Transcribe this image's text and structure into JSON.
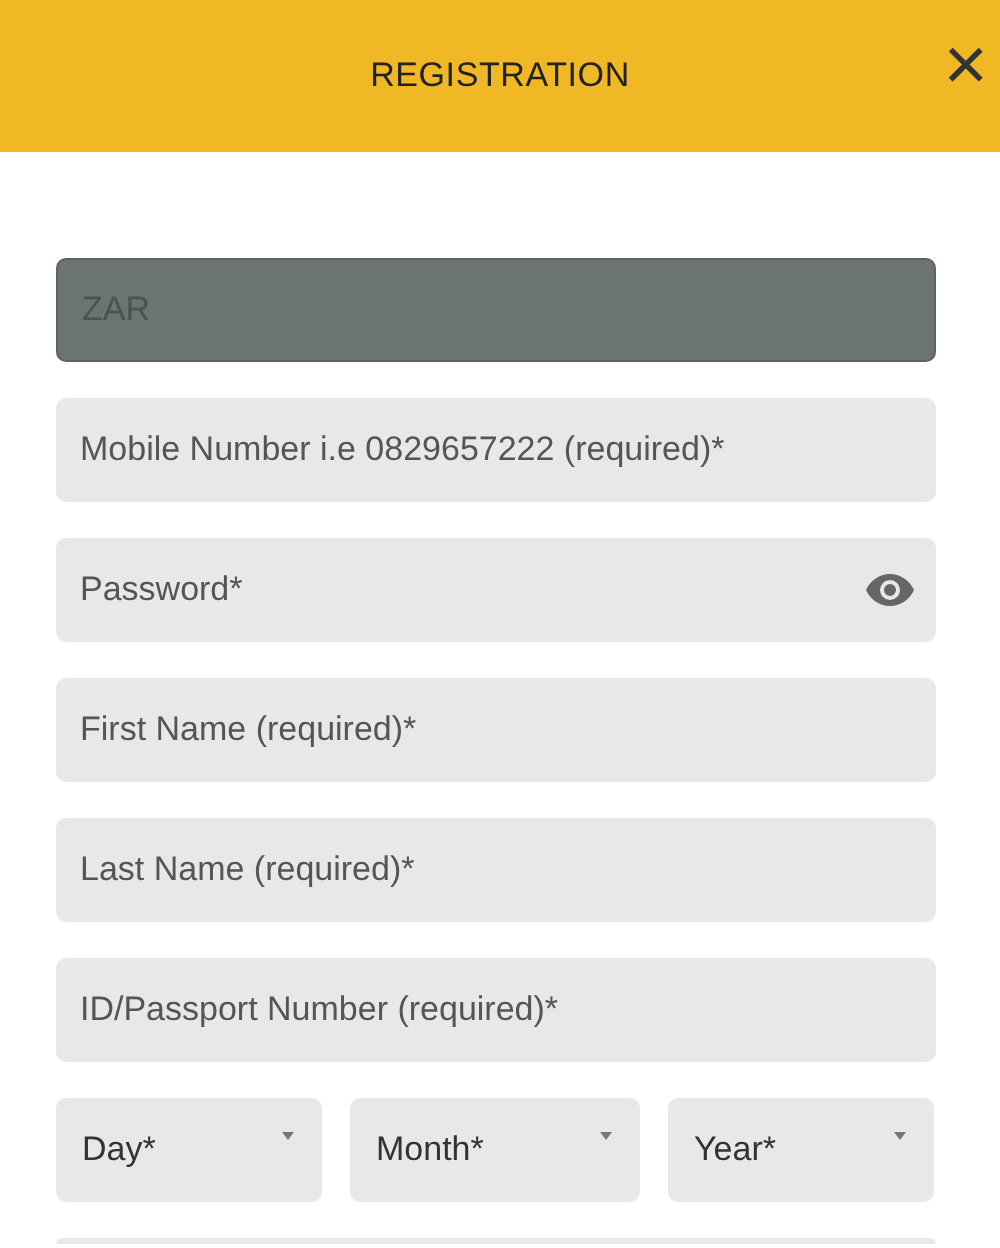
{
  "header": {
    "title": "REGISTRATION",
    "close": "×"
  },
  "fields": [
    {
      "kind": "text",
      "value": "ZAR",
      "disabled": true
    },
    {
      "kind": "text",
      "placeholder": "Mobile Number i.e 0829657222 (required)*",
      "disabled": false
    },
    {
      "kind": "password",
      "placeholder": "Password*",
      "disabled": false
    },
    {
      "kind": "text",
      "placeholder": "First Name (required)*",
      "disabled": false
    },
    {
      "kind": "text",
      "placeholder": "Last Name (required)*",
      "disabled": false
    },
    {
      "kind": "text",
      "placeholder": "ID/Passport Number (required)*",
      "disabled": false
    }
  ],
  "birth_date": [
    {
      "placeholder": "Day*"
    },
    {
      "placeholder": "Month*"
    },
    {
      "placeholder": "Year*"
    }
  ]
}
